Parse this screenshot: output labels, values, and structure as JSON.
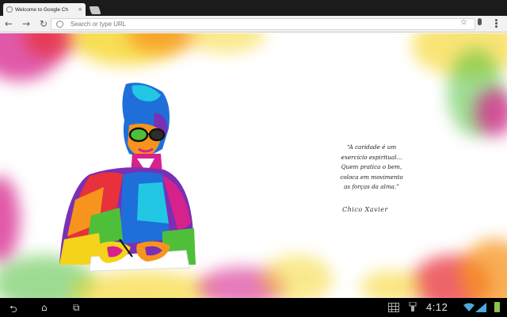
{
  "tab": {
    "title": "Welcome to Google Ch",
    "close_icon": "×"
  },
  "toolbar": {
    "back_icon": "←",
    "forward_icon": "→",
    "reload_icon": "↻",
    "omnibox_placeholder": "Search or type URL",
    "star_icon": "☆"
  },
  "page": {
    "quote_lines": [
      "“A caridade é um",
      "exercício espiritual...",
      "Quem pratica o bem,",
      "coloca em movimento",
      "as forças da alma.”"
    ],
    "signature": "Chico Xavier",
    "colors": {
      "red": "#e8313a",
      "yellow": "#f5d31a",
      "orange": "#f7941d",
      "magenta": "#d6228b",
      "blue": "#1e6fd9",
      "cyan": "#21c7e3",
      "green": "#4fbf3a",
      "purple": "#7b2fb5"
    }
  },
  "system_bar": {
    "back_icon": "⮌",
    "home_icon": "⌂",
    "recents_icon": "⧉",
    "clock": "4:12"
  }
}
